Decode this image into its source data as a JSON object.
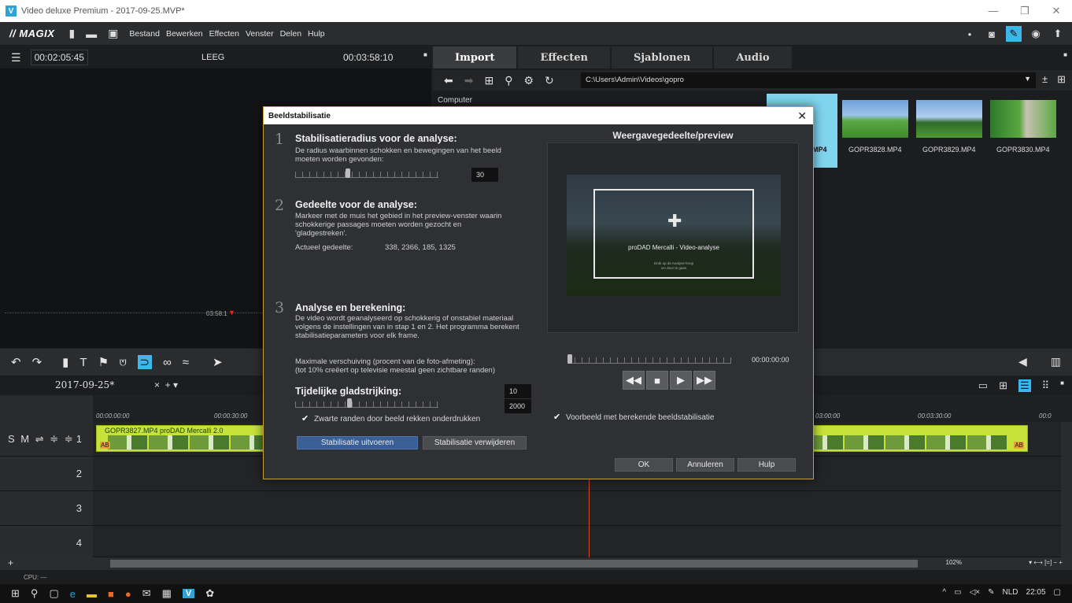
{
  "window": {
    "app_icon": "V",
    "title": "Video deluxe Premium - 2017-09-25.MVP*",
    "minimize": "—",
    "maximize": "❐",
    "close": "✕"
  },
  "menubar": {
    "logo": "// MAGIX",
    "items": [
      "Bestand",
      "Bewerken",
      "Effecten",
      "Venster",
      "Delen",
      "Hulp"
    ]
  },
  "preview": {
    "timecode_current": "00:02:05:45",
    "status": "LEEG",
    "timecode_total": "00:03:58:10",
    "marker_time": "03:58:1"
  },
  "media": {
    "tabs": [
      "Import",
      "Effecten",
      "Sjablonen",
      "Audio"
    ],
    "path": "C:\\Users\\Admin\\Videos\\gopro",
    "location": "Computer",
    "selected_label": "MP4",
    "files": [
      "GOPR3828.MP4",
      "GOPR3829.MP4",
      "GOPR3830.MP4"
    ]
  },
  "timeline": {
    "project_tab": "2017-09-25*",
    "ruler": [
      "00:00:00:00",
      "00:00:30:00",
      "03:00:00",
      "00:03:30:00",
      "00:0"
    ],
    "clip_title": "GOPR3827.MP4 proDAD Mercalli 2.0",
    "clip_badge": "AB",
    "track_controls": "S M ⇌ ≑ ≑",
    "tracks": [
      "1",
      "2",
      "3",
      "4"
    ],
    "zoom": "102%",
    "cpu": "CPU: —"
  },
  "dialog": {
    "title": "Beeldstabilisatie",
    "step1": {
      "num": "1",
      "heading": "Stabilisatieradius voor de analyse:",
      "desc_1": "De radius waarbinnen schokken en bewegingen van het beeld",
      "desc_2": "moeten worden gevonden:",
      "value": "30",
      "level": 0.37
    },
    "step2": {
      "num": "2",
      "heading": "Gedeelte voor de analyse:",
      "desc_1": "Markeer met de muis het gebied in het preview-venster waarin",
      "desc_2": "schokkerige passages moeten worden gezocht en",
      "desc_3": "'gladgestreken'.",
      "current_label": "Actueel gedeelte:",
      "current_value": "338, 2366, 185, 1325"
    },
    "step3": {
      "num": "3",
      "heading": "Analyse en berekening:",
      "desc_1": "De video wordt geanalyseerd op schokkerig of onstabiel materiaal",
      "desc_2": "volgens de instellingen van in stap 1 en 2. Het programma berekent",
      "desc_3": "stabilisatieparameters voor elk frame."
    },
    "max_shift_1": "Maximale verschuiving (procent van de foto-afmeting):",
    "max_shift_2": "(tot 10% creëert op televisie meestal geen zichtbare randen)",
    "max_shift_value": "10",
    "smoothing_label": "Tijdelijke gladstrijking:",
    "smoothing_value": "2000",
    "smoothing_level": 0.38,
    "black_borders": "Zwarte randen door beeld rekken onderdrukken",
    "btn_run": "Stabilisatie uitvoeren",
    "btn_remove": "Stabilisatie verwijderen",
    "preview_title": "Weergavegedeelte/preview",
    "preview_overlay": "proDAD Mercalli - Video-analyse",
    "preview_small_1": "Druk op de Analyse-knop",
    "preview_small_2": "om door te gaan",
    "preview_time": "00:00:00:00",
    "preview_checkbox": "Voorbeeld met berekende beeldstabilisatie",
    "btn_ok": "OK",
    "btn_cancel": "Annuleren",
    "btn_help": "Hulp"
  },
  "taskbar": {
    "tray_lang": "NLD",
    "tray_time": "22:05"
  }
}
